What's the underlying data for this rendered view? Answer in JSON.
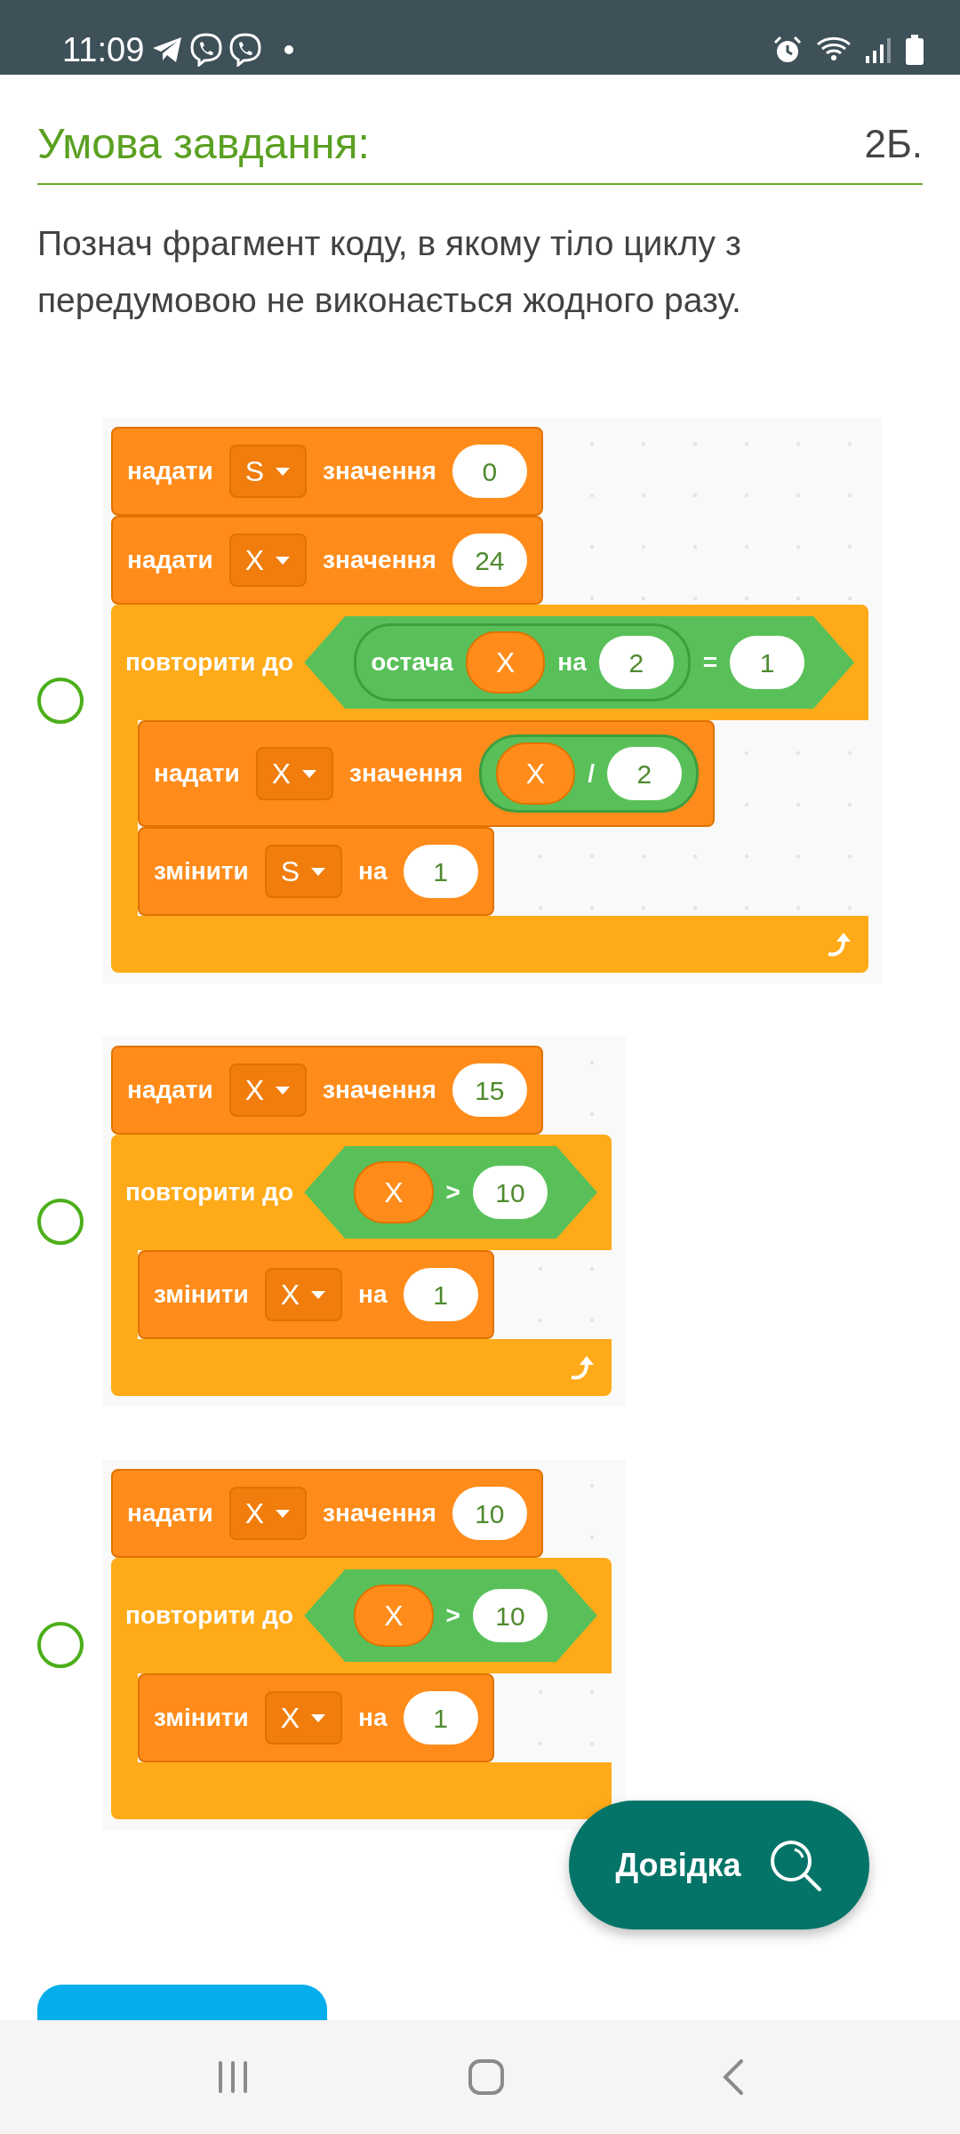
{
  "status_bar": {
    "time": "11:09"
  },
  "header": {
    "title": "Умова завдання:",
    "points": "2Б."
  },
  "question": "Познач фрагмент коду, в якому тіло циклу з передумовою не виконається жодного разу.",
  "options": [
    {
      "selected": false,
      "script": [
        {
          "kind": "stack",
          "parts": [
            {
              "kind": "text",
              "text": "надати"
            },
            {
              "kind": "dropdown",
              "text": "S"
            },
            {
              "kind": "text",
              "text": "значення"
            },
            {
              "kind": "number",
              "text": "0"
            }
          ]
        },
        {
          "kind": "stack",
          "parts": [
            {
              "kind": "text",
              "text": "надати"
            },
            {
              "kind": "dropdown",
              "text": "X"
            },
            {
              "kind": "text",
              "text": "значення"
            },
            {
              "kind": "number",
              "text": "24"
            }
          ]
        },
        {
          "kind": "loop",
          "return_arrow": true,
          "parts": [
            {
              "kind": "text",
              "text": "повторити до"
            },
            {
              "kind": "boolean",
              "parts": [
                {
                  "kind": "op",
                  "parts": [
                    {
                      "kind": "text",
                      "text": "остача"
                    },
                    {
                      "kind": "reporter",
                      "text": "X"
                    },
                    {
                      "kind": "text",
                      "text": "на"
                    },
                    {
                      "kind": "number",
                      "text": "2"
                    }
                  ]
                },
                {
                  "kind": "text",
                  "text": "="
                },
                {
                  "kind": "number",
                  "text": "1"
                }
              ]
            }
          ],
          "body": [
            {
              "kind": "stack",
              "parts": [
                {
                  "kind": "text",
                  "text": "надати"
                },
                {
                  "kind": "dropdown",
                  "text": "X"
                },
                {
                  "kind": "text",
                  "text": "значення"
                },
                {
                  "kind": "op",
                  "parts": [
                    {
                      "kind": "reporter",
                      "text": "X"
                    },
                    {
                      "kind": "text",
                      "text": "/"
                    },
                    {
                      "kind": "number",
                      "text": "2"
                    }
                  ]
                }
              ]
            },
            {
              "kind": "stack",
              "parts": [
                {
                  "kind": "text",
                  "text": "змінити"
                },
                {
                  "kind": "dropdown",
                  "text": "S"
                },
                {
                  "kind": "text",
                  "text": "на"
                },
                {
                  "kind": "number",
                  "text": "1"
                }
              ]
            }
          ]
        }
      ]
    },
    {
      "selected": false,
      "script": [
        {
          "kind": "stack",
          "parts": [
            {
              "kind": "text",
              "text": "надати"
            },
            {
              "kind": "dropdown",
              "text": "X"
            },
            {
              "kind": "text",
              "text": "значення"
            },
            {
              "kind": "number",
              "text": "15"
            }
          ]
        },
        {
          "kind": "loop",
          "return_arrow": true,
          "parts": [
            {
              "kind": "text",
              "text": "повторити до"
            },
            {
              "kind": "boolean",
              "parts": [
                {
                  "kind": "reporter",
                  "text": "X"
                },
                {
                  "kind": "text",
                  "text": ">"
                },
                {
                  "kind": "number",
                  "text": "10"
                }
              ]
            }
          ],
          "body": [
            {
              "kind": "stack",
              "parts": [
                {
                  "kind": "text",
                  "text": "змінити"
                },
                {
                  "kind": "dropdown",
                  "text": "X"
                },
                {
                  "kind": "text",
                  "text": "на"
                },
                {
                  "kind": "number",
                  "text": "1"
                }
              ]
            }
          ]
        }
      ]
    },
    {
      "selected": false,
      "script": [
        {
          "kind": "stack",
          "parts": [
            {
              "kind": "text",
              "text": "надати"
            },
            {
              "kind": "dropdown",
              "text": "X"
            },
            {
              "kind": "text",
              "text": "значення"
            },
            {
              "kind": "number",
              "text": "10"
            }
          ]
        },
        {
          "kind": "loop",
          "return_arrow": false,
          "parts": [
            {
              "kind": "text",
              "text": "повторити до"
            },
            {
              "kind": "boolean",
              "parts": [
                {
                  "kind": "reporter",
                  "text": "X"
                },
                {
                  "kind": "text",
                  "text": ">"
                },
                {
                  "kind": "number",
                  "text": "10"
                }
              ]
            }
          ],
          "body": [
            {
              "kind": "stack",
              "parts": [
                {
                  "kind": "text",
                  "text": "змінити"
                },
                {
                  "kind": "dropdown",
                  "text": "X"
                },
                {
                  "kind": "text",
                  "text": "на"
                },
                {
                  "kind": "number",
                  "text": "1"
                }
              ]
            }
          ]
        }
      ]
    }
  ],
  "help_button": {
    "label": "Довідка"
  }
}
